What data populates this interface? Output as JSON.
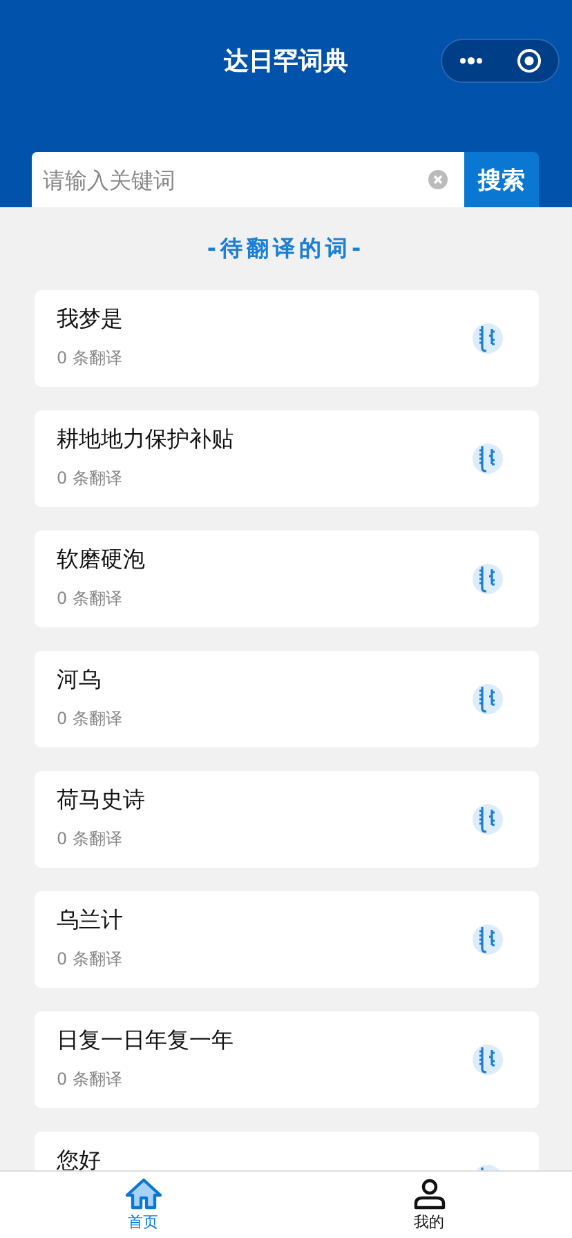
{
  "header": {
    "title": "达日罕词典"
  },
  "search": {
    "placeholder": "请输入关键词",
    "button": "搜索"
  },
  "section_title": "-待翻译的词-",
  "words": [
    {
      "word": "我梦是",
      "count": "0 条翻译"
    },
    {
      "word": "耕地地力保护补贴",
      "count": "0 条翻译"
    },
    {
      "word": "软磨硬泡",
      "count": "0 条翻译"
    },
    {
      "word": "河乌",
      "count": "0 条翻译"
    },
    {
      "word": "荷马史诗",
      "count": "0 条翻译"
    },
    {
      "word": "乌兰计",
      "count": "0 条翻译"
    },
    {
      "word": "日复一日年复一年",
      "count": "0 条翻译"
    },
    {
      "word": "您好"
    }
  ],
  "tabs": [
    {
      "label": "首页",
      "kind": "home",
      "selected": true
    },
    {
      "label": "我的",
      "kind": "profile",
      "selected": false
    }
  ]
}
